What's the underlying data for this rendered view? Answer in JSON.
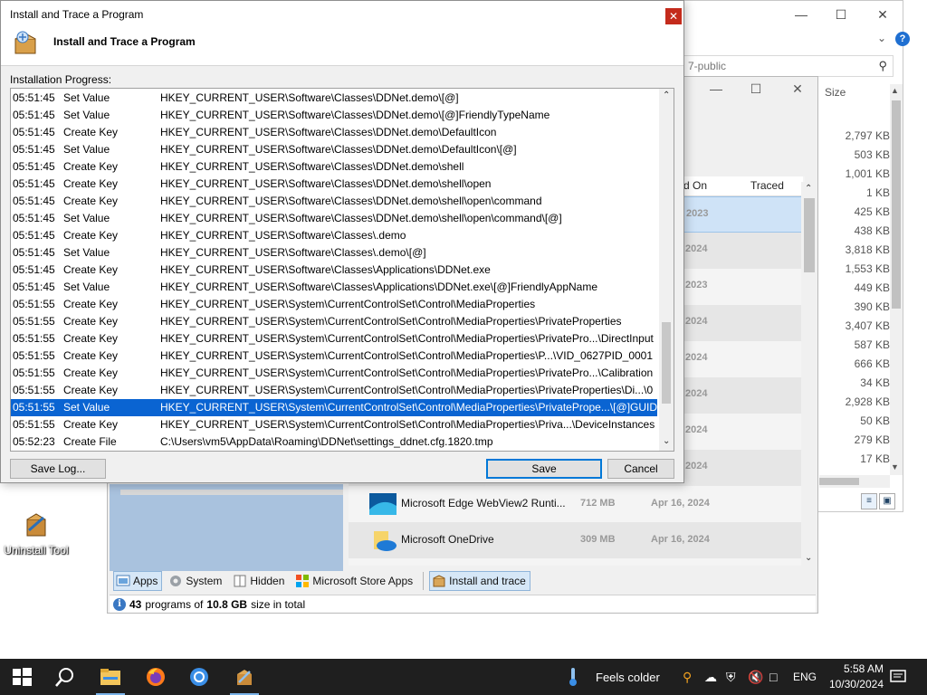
{
  "explorer": {
    "search_placeholder": "7-public",
    "size_header": "Size",
    "sizes": [
      "2,797 KB",
      "503 KB",
      "1,001 KB",
      "1 KB",
      "425 KB",
      "438 KB",
      "3,818 KB",
      "1,553 KB",
      "449 KB",
      "390 KB",
      "3,407 KB",
      "587 KB",
      "666 KB",
      "34 KB",
      "2,928 KB",
      "50 KB",
      "279 KB",
      "17 KB"
    ]
  },
  "uninstall_tool": {
    "columns": {
      "installed_on": "d On",
      "traced": "Traced"
    },
    "rows": [
      {
        "year": "2023"
      },
      {
        "year": "2024"
      },
      {
        "year": "2023"
      },
      {
        "year": "2024"
      },
      {
        "year": "2024"
      },
      {
        "year": "2024"
      },
      {
        "year": "2024"
      },
      {
        "year": "2024"
      }
    ],
    "apps": [
      {
        "name": "Microsoft Edge WebView2 Runti...",
        "size": "712 MB",
        "date": "Apr 16, 2024"
      },
      {
        "name": "Microsoft OneDrive",
        "size": "309 MB",
        "date": "Apr 16, 2024"
      }
    ],
    "tabs": [
      {
        "label": "Apps"
      },
      {
        "label": "System"
      },
      {
        "label": "Hidden"
      },
      {
        "label": "Microsoft Store Apps"
      },
      {
        "label": "Install and trace"
      }
    ],
    "status": {
      "count": "43",
      "programs_of": "programs of",
      "size": "10.8 GB",
      "suffix": "size in total"
    }
  },
  "desktop_icon": {
    "label": "Uninstall Tool"
  },
  "dialog": {
    "title": "Install and Trace a Program",
    "header": "Install and Trace a Program",
    "progress_label": "Installation Progress:",
    "log": [
      {
        "time": "05:51:45",
        "action": "Set Value",
        "path": "HKEY_CURRENT_USER\\Software\\Classes\\DDNet.demo\\[@]"
      },
      {
        "time": "05:51:45",
        "action": "Set Value",
        "path": "HKEY_CURRENT_USER\\Software\\Classes\\DDNet.demo\\[@]FriendlyTypeName"
      },
      {
        "time": "05:51:45",
        "action": "Create Key",
        "path": "HKEY_CURRENT_USER\\Software\\Classes\\DDNet.demo\\DefaultIcon"
      },
      {
        "time": "05:51:45",
        "action": "Set Value",
        "path": "HKEY_CURRENT_USER\\Software\\Classes\\DDNet.demo\\DefaultIcon\\[@]"
      },
      {
        "time": "05:51:45",
        "action": "Create Key",
        "path": "HKEY_CURRENT_USER\\Software\\Classes\\DDNet.demo\\shell"
      },
      {
        "time": "05:51:45",
        "action": "Create Key",
        "path": "HKEY_CURRENT_USER\\Software\\Classes\\DDNet.demo\\shell\\open"
      },
      {
        "time": "05:51:45",
        "action": "Create Key",
        "path": "HKEY_CURRENT_USER\\Software\\Classes\\DDNet.demo\\shell\\open\\command"
      },
      {
        "time": "05:51:45",
        "action": "Set Value",
        "path": "HKEY_CURRENT_USER\\Software\\Classes\\DDNet.demo\\shell\\open\\command\\[@]"
      },
      {
        "time": "05:51:45",
        "action": "Create Key",
        "path": "HKEY_CURRENT_USER\\Software\\Classes\\.demo"
      },
      {
        "time": "05:51:45",
        "action": "Set Value",
        "path": "HKEY_CURRENT_USER\\Software\\Classes\\.demo\\[@]"
      },
      {
        "time": "05:51:45",
        "action": "Create Key",
        "path": "HKEY_CURRENT_USER\\Software\\Classes\\Applications\\DDNet.exe"
      },
      {
        "time": "05:51:45",
        "action": "Set Value",
        "path": "HKEY_CURRENT_USER\\Software\\Classes\\Applications\\DDNet.exe\\[@]FriendlyAppName"
      },
      {
        "time": "05:51:55",
        "action": "Create Key",
        "path": "HKEY_CURRENT_USER\\System\\CurrentControlSet\\Control\\MediaProperties"
      },
      {
        "time": "05:51:55",
        "action": "Create Key",
        "path": "HKEY_CURRENT_USER\\System\\CurrentControlSet\\Control\\MediaProperties\\PrivateProperties"
      },
      {
        "time": "05:51:55",
        "action": "Create Key",
        "path": "HKEY_CURRENT_USER\\System\\CurrentControlSet\\Control\\MediaProperties\\PrivatePro...\\DirectInput"
      },
      {
        "time": "05:51:55",
        "action": "Create Key",
        "path": "HKEY_CURRENT_USER\\System\\CurrentControlSet\\Control\\MediaProperties\\P...\\VID_0627PID_0001"
      },
      {
        "time": "05:51:55",
        "action": "Create Key",
        "path": "HKEY_CURRENT_USER\\System\\CurrentControlSet\\Control\\MediaProperties\\PrivatePro...\\Calibration"
      },
      {
        "time": "05:51:55",
        "action": "Create Key",
        "path": "HKEY_CURRENT_USER\\System\\CurrentControlSet\\Control\\MediaProperties\\PrivateProperties\\Di...\\0"
      },
      {
        "time": "05:51:55",
        "action": "Set Value",
        "path": "HKEY_CURRENT_USER\\System\\CurrentControlSet\\Control\\MediaProperties\\PrivatePrope...\\[@]GUID"
      },
      {
        "time": "05:51:55",
        "action": "Create Key",
        "path": "HKEY_CURRENT_USER\\System\\CurrentControlSet\\Control\\MediaProperties\\Priva...\\DeviceInstances"
      },
      {
        "time": "05:52:23",
        "action": "Create File",
        "path": "C:\\Users\\vm5\\AppData\\Roaming\\DDNet\\settings_ddnet.cfg.1820.tmp"
      }
    ],
    "selected_row": 18,
    "buttons": {
      "save_log": "Save Log...",
      "save": "Save",
      "cancel": "Cancel"
    }
  },
  "taskbar": {
    "weather": "Feels colder",
    "language": "ENG",
    "time": "5:58 AM",
    "date": "10/30/2024"
  },
  "colors": {
    "selection": "#0a64d2",
    "close_red": "#c42b1c",
    "taskbar": "#1f1f1f",
    "accent_blue": "#0078d7"
  }
}
